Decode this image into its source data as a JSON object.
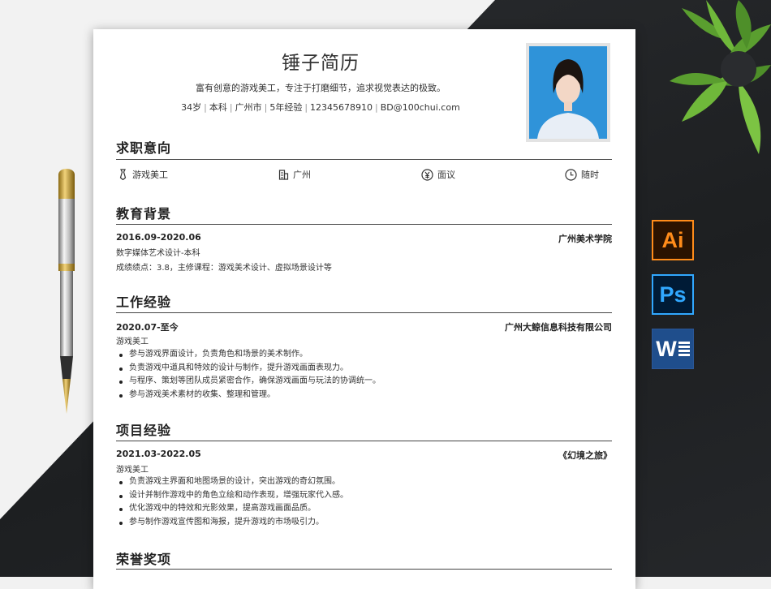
{
  "resume": {
    "name": "锤子简历",
    "tagline": "富有创意的游戏美工，专注于打磨细节，追求视觉表达的极致。",
    "info": {
      "age": "34岁",
      "degree": "本科",
      "city": "广州市",
      "experience": "5年经验",
      "phone": "12345678910",
      "email": "BD@100chui.com"
    },
    "sections": {
      "intent": "求职意向",
      "education": "教育背景",
      "work": "工作经验",
      "projects": "项目经验",
      "honors": "荣誉奖项"
    },
    "intent": {
      "position": "游戏美工",
      "city": "广州",
      "salary": "面议",
      "availability": "随时"
    },
    "education": {
      "period": "2016.09-2020.06",
      "school": "广州美术学院",
      "major": "数字媒体艺术设计-本科",
      "details": "成绩绩点：3.8，主修课程：游戏美术设计、虚拟场景设计等"
    },
    "work": {
      "period": "2020.07-至今",
      "company": "广州大鲸信息科技有限公司",
      "role": "游戏美工",
      "bullets": [
        "参与游戏界面设计，负责角色和场景的美术制作。",
        "负责游戏中道具和特效的设计与制作，提升游戏画面表现力。",
        "与程序、策划等团队成员紧密合作，确保游戏画面与玩法的协调统一。",
        "参与游戏美术素材的收集、整理和管理。"
      ]
    },
    "project": {
      "period": "2021.03-2022.05",
      "name": "《幻境之旅》",
      "role": "游戏美工",
      "bullets": [
        "负责游戏主界面和地图场景的设计，突出游戏的奇幻氛围。",
        "设计并制作游戏中的角色立绘和动作表现，增强玩家代入感。",
        "优化游戏中的特效和光影效果，提高游戏画面品质。",
        "参与制作游戏宣传图和海报，提升游戏的市场吸引力。"
      ]
    }
  },
  "decor": {
    "app_icons": {
      "ai": "Ai",
      "ps": "Ps",
      "word": "W"
    },
    "icons": [
      "tie-icon",
      "building-icon",
      "yen-icon",
      "clock-icon",
      "plant",
      "fountain-pen"
    ],
    "colors": {
      "dark_bg": "#222426",
      "ai_orange": "#ff8c1a",
      "ps_blue": "#31a8ff",
      "word_blue": "#1f4e8c"
    }
  }
}
